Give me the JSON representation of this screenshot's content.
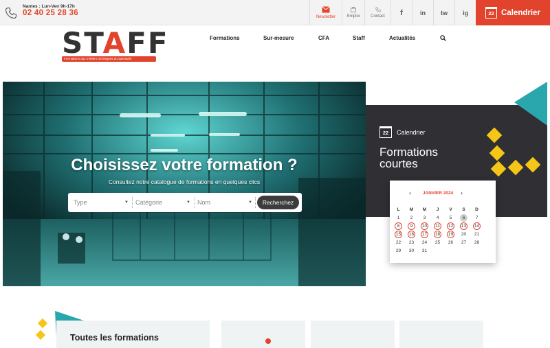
{
  "topbar": {
    "phone_hours": "Nantes : Lun-Ven 9h-17h",
    "phone_number": "02 40 25 28 36",
    "newsletter": "Newsletter",
    "emploi": "Emploi",
    "contact": "Contact",
    "social": [
      "f",
      "in",
      "tw",
      "ig"
    ],
    "calendar_button": "Calendrier",
    "calendar_icon_day": "22"
  },
  "logo": {
    "word_pre": "ST",
    "word_a": "A",
    "word_post": "FF",
    "tagline": "Formations aux métiers techniques du spectacle"
  },
  "nav": [
    "Formations",
    "Sur-mesure",
    "CFA",
    "Staff",
    "Actualités"
  ],
  "hero": {
    "title": "Choisissez votre formation ?",
    "subtitle": "Consultez notre catalogue de formations en quelques clics",
    "select_type": "Type",
    "select_categorie": "Catégorie",
    "select_nom": "Nom",
    "search_button": "Recherchez"
  },
  "calendar_panel": {
    "icon_day": "22",
    "label": "Calendrier",
    "title_line1": "Formations",
    "title_line2": "courtes",
    "month": "JANVIER 2024",
    "prev": "‹",
    "next": "›",
    "weekdays": [
      "L",
      "M",
      "M",
      "J",
      "V",
      "S",
      "D"
    ],
    "weeks": [
      [
        "1",
        "2",
        "3",
        "4",
        "5",
        "6",
        "7"
      ],
      [
        "8",
        "9",
        "10",
        "11",
        "12",
        "13",
        "14"
      ],
      [
        "15",
        "16",
        "17",
        "18",
        "19",
        "20",
        "21"
      ],
      [
        "22",
        "23",
        "24",
        "25",
        "26",
        "27",
        "28"
      ],
      [
        "29",
        "30",
        "31",
        "",
        "",
        "",
        ""
      ]
    ],
    "event_days": [
      "8",
      "9",
      "10",
      "11",
      "12",
      "13",
      "14",
      "15",
      "16",
      "17",
      "18",
      "19"
    ],
    "today": "6"
  },
  "bottom": {
    "card_title": "Toutes les formations"
  },
  "colors": {
    "accent": "#e2432c",
    "teal": "#2aa6ad",
    "yellow": "#f5c518",
    "dark_panel": "#2f2f34"
  }
}
